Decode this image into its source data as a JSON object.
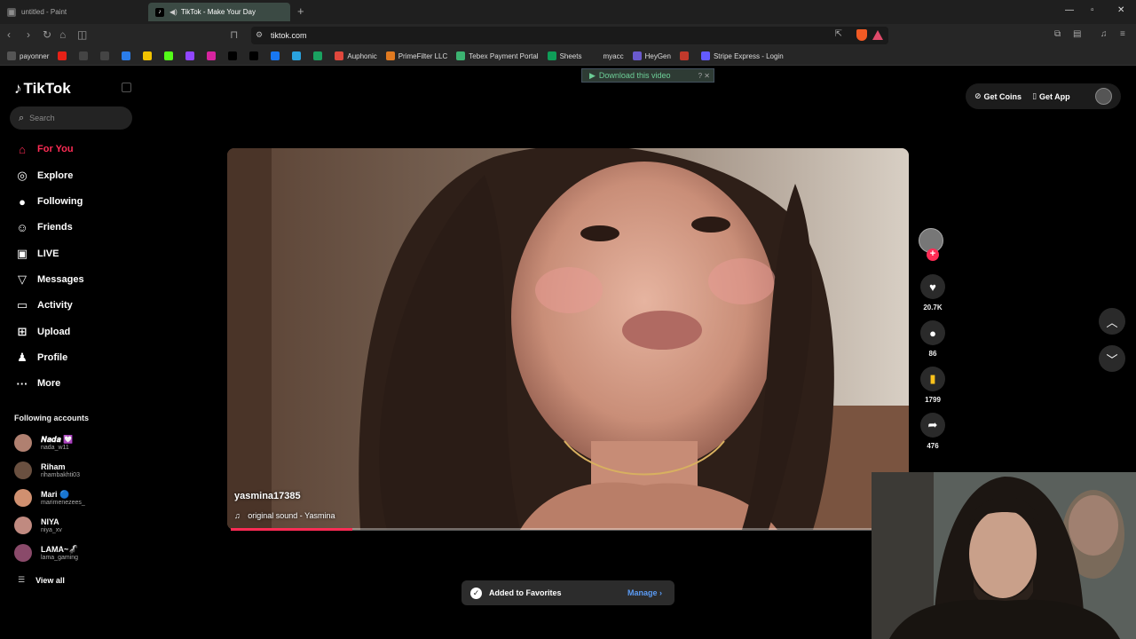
{
  "browser": {
    "tabs": [
      {
        "title": "untitled - Paint",
        "active": false
      },
      {
        "title": "TikTok - Make Your Day",
        "active": true
      }
    ],
    "url": "tiktok.com",
    "bookmarks": [
      {
        "label": "payonner",
        "icon": "payoneer-icon",
        "color": "#555"
      },
      {
        "label": "",
        "icon": "youtube-icon",
        "color": "#e62117"
      },
      {
        "label": "",
        "icon": "bookmark-icon",
        "color": "#444"
      },
      {
        "label": "",
        "icon": "app-icon",
        "color": "#444"
      },
      {
        "label": "",
        "icon": "app-icon",
        "color": "#2b7de9"
      },
      {
        "label": "",
        "icon": "app-icon",
        "color": "#f2c200"
      },
      {
        "label": "",
        "icon": "kick-icon",
        "color": "#53fc18"
      },
      {
        "label": "",
        "icon": "twitch-icon",
        "color": "#9146ff"
      },
      {
        "label": "",
        "icon": "instagram-icon",
        "color": "#d6249f"
      },
      {
        "label": "",
        "icon": "tiktok-icon",
        "color": "#000"
      },
      {
        "label": "",
        "icon": "x-icon",
        "color": "#000"
      },
      {
        "label": "",
        "icon": "facebook-icon",
        "color": "#1877f2"
      },
      {
        "label": "",
        "icon": "telegram-icon",
        "color": "#2aa3df"
      },
      {
        "label": "",
        "icon": "app-icon",
        "color": "#1aa260"
      },
      {
        "label": "Auphonic",
        "icon": "auphonic-icon",
        "color": "#e0483d"
      },
      {
        "label": "PrimeFilter LLC",
        "icon": "primefilter-icon",
        "color": "#e07a20"
      },
      {
        "label": "Tebex Payment Portal",
        "icon": "tebex-icon",
        "color": "#3cb371"
      },
      {
        "label": "Sheets",
        "icon": "sheets-icon",
        "color": "#0f9d58"
      },
      {
        "label": "myacc",
        "icon": "folder-icon",
        "color": "#262626"
      },
      {
        "label": "HeyGen",
        "icon": "heygen-icon",
        "color": "#6a5acd"
      },
      {
        "label": "",
        "icon": "app-icon",
        "color": "#c0392b"
      },
      {
        "label": "Stripe Express - Login",
        "icon": "stripe-icon",
        "color": "#635bff"
      }
    ]
  },
  "overlay": {
    "download_label": "Download this video"
  },
  "sidebar": {
    "logo": "TikTok",
    "search_placeholder": "Search",
    "nav": [
      {
        "label": "For You",
        "icon": "home-icon",
        "glyph": "⌂",
        "active": true
      },
      {
        "label": "Explore",
        "icon": "compass-icon",
        "glyph": "◎",
        "active": false
      },
      {
        "label": "Following",
        "icon": "following-avatar-icon",
        "glyph": "●",
        "active": false
      },
      {
        "label": "Friends",
        "icon": "friends-icon",
        "glyph": "☺",
        "active": false
      },
      {
        "label": "LIVE",
        "icon": "live-icon",
        "glyph": "▣",
        "active": false
      },
      {
        "label": "Messages",
        "icon": "messages-icon",
        "glyph": "▽",
        "active": false
      },
      {
        "label": "Activity",
        "icon": "activity-icon",
        "glyph": "▭",
        "active": false
      },
      {
        "label": "Upload",
        "icon": "upload-icon",
        "glyph": "⊞",
        "active": false
      },
      {
        "label": "Profile",
        "icon": "profile-icon",
        "glyph": "♟",
        "active": false
      },
      {
        "label": "More",
        "icon": "more-icon",
        "glyph": "···",
        "active": false
      }
    ],
    "following_title": "Following accounts",
    "accounts": [
      {
        "name": "𝑵𝒂𝒅𝒂 💟",
        "handle": "nada_w11",
        "color": "#b08070"
      },
      {
        "name": "Riham",
        "handle": "rihambakhti03",
        "color": "#6a5040"
      },
      {
        "name": "Mari 🔵",
        "handle": "marimenezees_",
        "color": "#d09070"
      },
      {
        "name": "NIYA",
        "handle": "niya_xv",
        "color": "#c08a80"
      },
      {
        "name": "LAMA~🦨",
        "handle": "lama_gaming",
        "color": "#8a4a6a"
      }
    ],
    "view_all": "View all"
  },
  "header": {
    "get_coins": "Get Coins",
    "get_app": "Get App"
  },
  "video": {
    "username": "yasmina17385",
    "sound": "original sound - Yasmina",
    "progress": 0.19
  },
  "actions": {
    "likes": "20.7K",
    "comments": "86",
    "favorites": "1799",
    "shares": "476"
  },
  "toast": {
    "message": "Added to Favorites",
    "action": "Manage"
  }
}
